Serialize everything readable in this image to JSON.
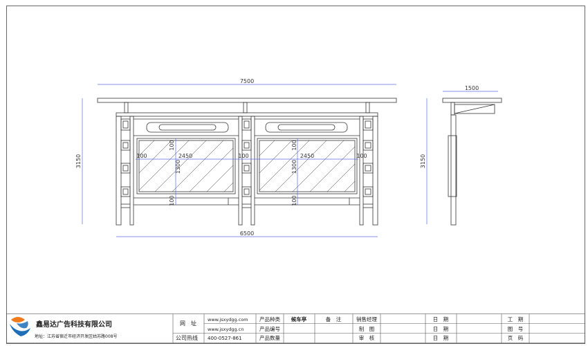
{
  "drawing": {
    "dims": {
      "top_width": "7500",
      "bottom_width": "6500",
      "front_height": "3150",
      "panel_width_left": "2450",
      "panel_width_right": "2450",
      "panel_height_left": "1300",
      "panel_height_right": "1300",
      "small_100_a": "100",
      "small_100_b": "100",
      "small_100_c": "100",
      "small_100_d": "100",
      "small_100_e": "100",
      "small_100_f": "100",
      "small_100_g": "100",
      "side_width": "1500",
      "side_height": "3150"
    }
  },
  "title_block": {
    "company_name": "鑫易达广告科技有限公司",
    "address": "地址：江苏省宿迁市经济开发区姑苏路008号",
    "labels": {
      "website": "网　址",
      "hotline": "公司热线",
      "product_type": "产品种类",
      "product_code": "产品编号",
      "product_qty": "产品数量",
      "remark": "备　注",
      "sales_manager": "销售经理",
      "drafting": "制　图",
      "review": "审　核",
      "date1": "日　期",
      "date2": "日　期",
      "date3": "日　期",
      "job_no": "工　期",
      "drawing_no": "图　号",
      "page_no": "页　码"
    },
    "values": {
      "website_1": "www.jsxydgg.com",
      "website_2": "www.jsxydgg.cn",
      "hotline": "400-0527-861",
      "product_type": "候车亭"
    },
    "colors": {
      "logo_orange": "#f07b1d",
      "logo_blue": "#1f6fb8",
      "dim_blue": "#5a6ee0"
    }
  }
}
